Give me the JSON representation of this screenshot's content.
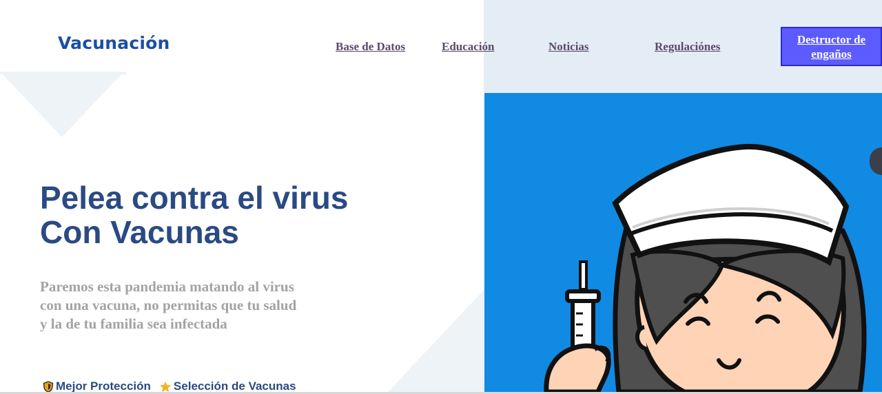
{
  "header": {
    "logo": "Vacunación",
    "nav": [
      {
        "label": "Base de Datos"
      },
      {
        "label": "Educación"
      },
      {
        "label": "Noticias"
      },
      {
        "label": "Regulaciónes"
      }
    ],
    "cta_line1": "Destructor de",
    "cta_line2": "engaños"
  },
  "hero": {
    "title_line1": "Pelea contra el virus",
    "title_line2": "Con Vacunas",
    "subtitle_line1": "Paremos esta pandemia matando al virus",
    "subtitle_line2": "con una vacuna, no permitas que tu salud",
    "subtitle_line3": "y la de tu familia sea infectada"
  },
  "features": [
    {
      "label": "Mejor Protección",
      "icon": "shield-icon"
    },
    {
      "label": "Selección de Vacunas",
      "icon": "star-icon"
    }
  ],
  "colors": {
    "brand": "#1c4fa3",
    "heading": "#2a4a82",
    "subtitle": "#a3a3a3",
    "cta_background": "#5b5bff",
    "illustration_background": "#118ae3"
  }
}
